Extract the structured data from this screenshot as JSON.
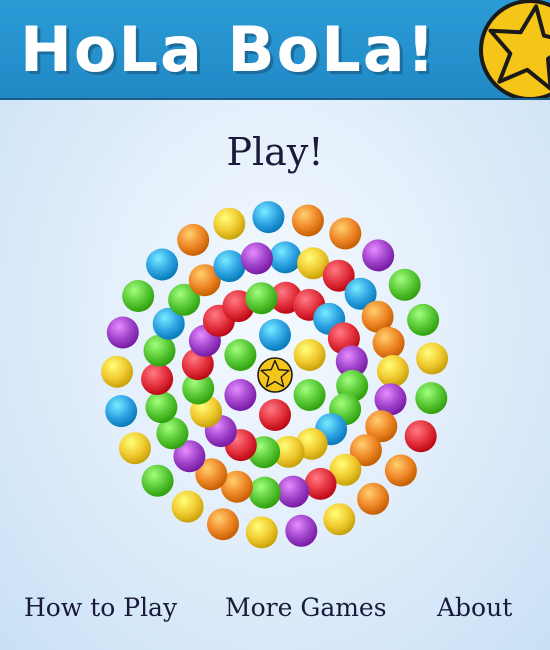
{
  "header": {
    "title": "HoLa BoLa!",
    "logo_icon": "star-coin-icon"
  },
  "menu": {
    "play_label": "Play!",
    "nav": [
      {
        "id": "how",
        "label": "How to Play"
      },
      {
        "id": "more",
        "label": "More Games"
      },
      {
        "id": "about",
        "label": "About"
      }
    ]
  },
  "board": {
    "center_icon": "gold-star-ball",
    "palette": {
      "P": "#a246cd",
      "G": "#5ccb39",
      "Y": "#f2cd33",
      "O": "#f08a2a",
      "B": "#32a6e5",
      "R": "#e5343f"
    },
    "rings": [
      {
        "colors": "BYGRPG"
      },
      {
        "colors": "RRBRPGGBYYGRPYGRPRRG"
      },
      {
        "colors": "BYRBOOYPOOYRPGOOPGGRGBGOBP"
      },
      {
        "colors": "OOPGGYGROOYPYOYGYBYPGBOYB"
      }
    ]
  },
  "colors": {
    "header_bg": "#2190cb",
    "header_shadow": "#1b6d9c",
    "text": "#1a1a3a",
    "star_gold": "#f5c518"
  }
}
